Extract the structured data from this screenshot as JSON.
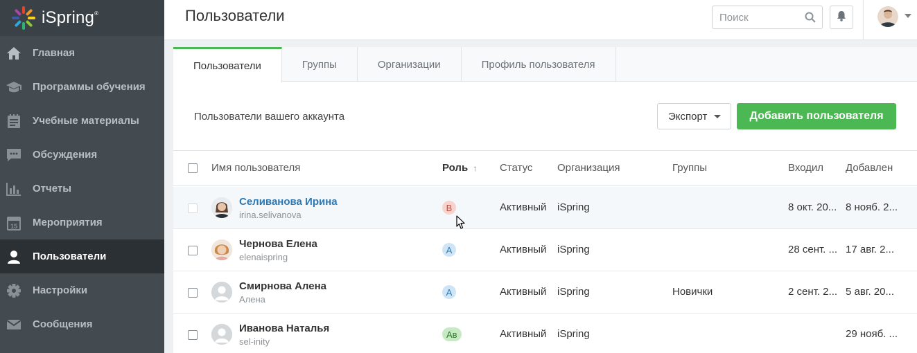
{
  "app": {
    "logo_text": "iSpring"
  },
  "sidebar": {
    "items": [
      {
        "label": "Главная",
        "icon": "home-icon"
      },
      {
        "label": "Программы обучения",
        "icon": "graduation-cap-icon"
      },
      {
        "label": "Учебные материалы",
        "icon": "materials-icon"
      },
      {
        "label": "Обсуждения",
        "icon": "chat-icon"
      },
      {
        "label": "Отчеты",
        "icon": "bar-chart-icon"
      },
      {
        "label": "Мероприятия",
        "icon": "calendar-icon"
      },
      {
        "label": "Пользователи",
        "icon": "user-icon",
        "active": true
      },
      {
        "label": "Настройки",
        "icon": "gear-icon"
      },
      {
        "label": "Сообщения",
        "icon": "mail-icon"
      }
    ]
  },
  "header": {
    "title": "Пользователи",
    "search_placeholder": "Поиск"
  },
  "tabs": [
    {
      "label": "Пользователи",
      "active": true
    },
    {
      "label": "Группы"
    },
    {
      "label": "Организации"
    },
    {
      "label": "Профиль пользователя"
    }
  ],
  "toolbar": {
    "subtitle": "Пользователи вашего аккаунта",
    "export_label": "Экспорт",
    "add_label": "Добавить пользователя"
  },
  "table": {
    "columns": {
      "name": "Имя пользователя",
      "role": "Роль",
      "role_sort": "↑",
      "status": "Статус",
      "org": "Организация",
      "groups": "Группы",
      "login": "Входил",
      "added": "Добавлен"
    },
    "rows": [
      {
        "name": "Селиванова Ирина",
        "login": "irina.selivanova",
        "role": "В",
        "status": "Активный",
        "org": "iSpring",
        "groups": "",
        "last_login": "8 окт. 20...",
        "added": "8 нояб. 2..."
      },
      {
        "name": "Чернова Елена",
        "login": "elenaispring",
        "role": "А",
        "status": "Активный",
        "org": "iSpring",
        "groups": "",
        "last_login": "28 сент. ...",
        "added": "17 авг. 2..."
      },
      {
        "name": "Смирнова Алена",
        "login": "Алена",
        "role": "А",
        "status": "Активный",
        "org": "iSpring",
        "groups": "Новички",
        "last_login": "2 сент. 2...",
        "added": "5 авг. 20..."
      },
      {
        "name": "Иванова Наталья",
        "login": "sel-inity",
        "role": "Ав",
        "status": "Активный",
        "org": "iSpring",
        "groups": "",
        "last_login": "",
        "added": "29 нояб. ..."
      }
    ]
  },
  "colors": {
    "sidebar_bg": "#434a50",
    "sidebar_active": "#2b3035",
    "accent_green": "#4cb853",
    "link_blue": "#2b78b5"
  }
}
